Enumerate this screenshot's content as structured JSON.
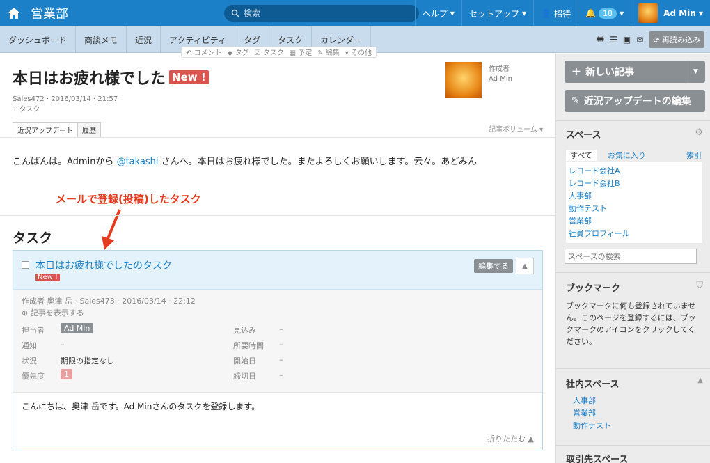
{
  "header": {
    "title": "営業部",
    "search_placeholder": "検索",
    "nav": {
      "help": "ヘルプ",
      "setup": "セットアップ",
      "invite": "招待",
      "notifications": "18",
      "user": "Ad Min"
    }
  },
  "tabs": [
    "ダッシュボード",
    "商談メモ",
    "近況",
    "アクティビティ",
    "タグ",
    "タスク",
    "カレンダー"
  ],
  "toolbar": {
    "reload": "再読み込み"
  },
  "subactions": [
    "コメント",
    "タグ",
    "タスク",
    "予定",
    "編集",
    "その他"
  ],
  "post": {
    "title": "本日はお疲れ様でした",
    "new": "New !",
    "meta1": "Sales472 · 2016/03/14 · 21:57",
    "meta2": "1 タスク",
    "author_label": "作成者",
    "author": "Ad Min",
    "tabs": [
      "近況アップデート",
      "履歴"
    ],
    "volume": "記事ボリューム",
    "body_pre": "こんばんは。Adminから ",
    "mention": "@takashi",
    "body_post": " さんへ。本日はお疲れ様でした。またよろしくお願いします。云々。あどみん"
  },
  "annotation": "メールで登録(投稿)したタスク",
  "task": {
    "heading": "タスク",
    "title": "本日はお疲れ様でしたのタスク",
    "new": "New !",
    "edit": "編集する",
    "meta1": "作成者 奥津 岳 · Sales473 · 2016/03/14 · 22:12",
    "meta2": "記事を表示する",
    "fields": {
      "assignee_l": "担当者",
      "assignee": "Ad Min",
      "notify_l": "通知",
      "notify": "–",
      "status_l": "状況",
      "status": "期限の指定なし",
      "priority_l": "優先度",
      "priority": "1",
      "estimate_l": "見込み",
      "estimate": "–",
      "required_l": "所要時間",
      "required": "–",
      "start_l": "開始日",
      "start": "–",
      "due_l": "締切日",
      "due": "–"
    },
    "body": "こんにちは、奥津 岳です。Ad Minさんのタスクを登録します。",
    "fold": "折りたたむ"
  },
  "sidebar": {
    "new_post": "新しい記事",
    "edit_update": "近況アップデートの編集",
    "spaces": "スペース",
    "tab_all": "すべて",
    "tab_fav": "お気に入り",
    "index": "索引",
    "space_list": [
      "レコード会社A",
      "レコード会社B",
      "人事部",
      "動作テスト",
      "営業部",
      "社員プロフィール"
    ],
    "space_search": "スペースの検索",
    "bookmarks": "ブックマーク",
    "bookmark_text": "ブックマークに何も登録されていません。このページを登録するには、ブックマークのアイコンをクリックしてください。",
    "internal": "社内スペース",
    "internal_list": [
      "人事部",
      "営業部",
      "動作テスト"
    ],
    "clients": "取引先スペース"
  }
}
